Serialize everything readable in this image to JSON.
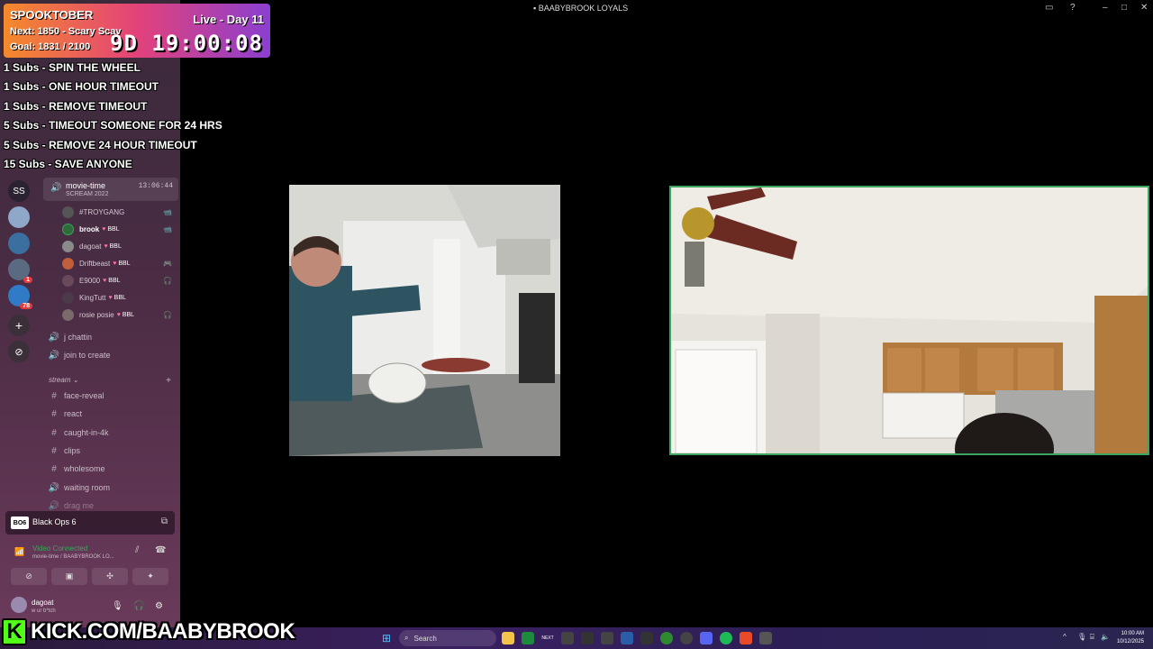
{
  "window": {
    "title": "BAABYBROOK LOYALS"
  },
  "overlay": {
    "event_title": "SPOOKTOBER",
    "next_goal": "Next: 1850 - Scary Scav",
    "goal_progress": "Goal: 1831 / 2100",
    "live_day": "Live - Day 11",
    "timer": "9D  19:00:08",
    "rewards": [
      "1 Subs - SPIN THE WHEEL",
      "1 Subs - ONE HOUR TIMEOUT",
      "1 Subs - REMOVE TIMEOUT",
      "5 Subs - TIMEOUT SOMEONE FOR 24 HRS",
      "5 Subs - REMOVE 24 HOUR TIMEOUT",
      "15 Subs - SAVE ANYONE"
    ],
    "kick_logo": "K",
    "kick_url": "KICK.COM/BAABYBROOK"
  },
  "server_rail": {
    "items": [
      {
        "label": "SS",
        "badge": ""
      },
      {
        "label": "",
        "badge": ""
      },
      {
        "label": "",
        "badge": ""
      },
      {
        "label": "",
        "badge": "1"
      },
      {
        "label": "",
        "badge": "78"
      }
    ]
  },
  "voice_channel": {
    "name": "movie-time",
    "subtitle": "SCREAM 2022",
    "elapsed": "13:06:44"
  },
  "members": [
    {
      "name": "#TROYGANG",
      "tag": "",
      "icon": "📹"
    },
    {
      "name": "brook",
      "tag": "BBL",
      "icon": "📹"
    },
    {
      "name": "dagoat",
      "tag": "BBL",
      "icon": ""
    },
    {
      "name": "Driftbeast",
      "tag": "BBL",
      "icon": "🎮"
    },
    {
      "name": "E9000",
      "tag": "BBL",
      "icon": "🎧"
    },
    {
      "name": "KingTutt",
      "tag": "BBL",
      "icon": ""
    },
    {
      "name": "rosie posie",
      "tag": "BBL",
      "icon": "🎧"
    }
  ],
  "channels_top": [
    {
      "name": "j chattin",
      "type": "voice"
    },
    {
      "name": "join to create",
      "type": "voice"
    }
  ],
  "category": {
    "name": "stream"
  },
  "channels_stream": [
    {
      "name": "face-reveal",
      "type": "text"
    },
    {
      "name": "react",
      "type": "text"
    },
    {
      "name": "caught-in-4k",
      "type": "text"
    },
    {
      "name": "clips",
      "type": "text"
    },
    {
      "name": "wholesome",
      "type": "text"
    },
    {
      "name": "waiting room",
      "type": "voice"
    },
    {
      "name": "drag me",
      "type": "voice"
    }
  ],
  "game": {
    "icon_text": "BO6",
    "name": "Black Ops 6"
  },
  "voice_status": {
    "title": "Video Connected",
    "subtitle": "movie-time / BAABYBROOK LO..."
  },
  "user": {
    "name": "dagoat",
    "status": "w ur b*tch"
  },
  "taskbar": {
    "search_placeholder": "Search",
    "time": "10:00 AM",
    "date": "10/12/2025"
  },
  "colors": {
    "connected": "#3ba55d",
    "kick_green": "#53fc18",
    "accent_pink": "#ff6fa8"
  }
}
